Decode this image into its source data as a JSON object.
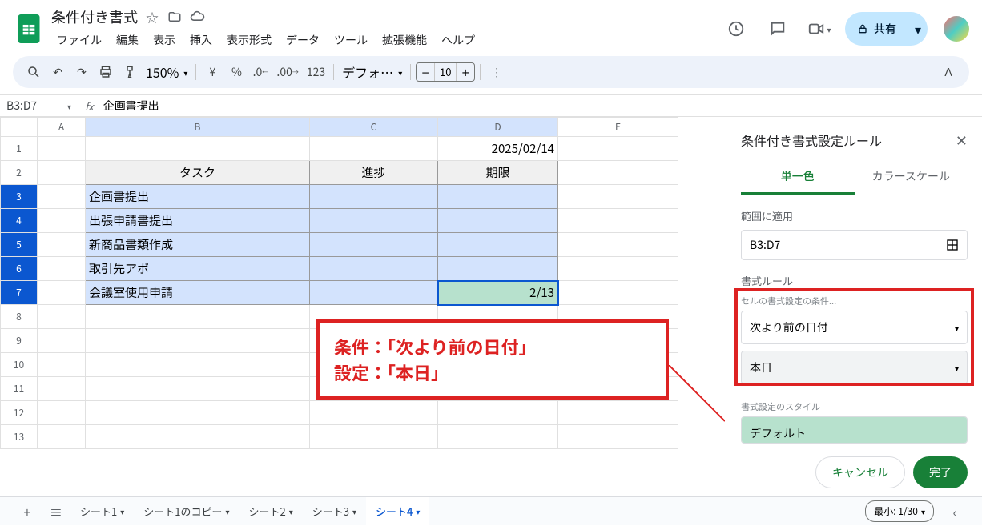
{
  "header": {
    "doc_title": "条件付き書式",
    "menus": [
      "ファイル",
      "編集",
      "表示",
      "挿入",
      "表示形式",
      "データ",
      "ツール",
      "拡張機能",
      "ヘルプ"
    ],
    "share_label": "共有"
  },
  "toolbar": {
    "zoom": "150%",
    "currency": "¥",
    "percent": "%",
    "font_name": "デフォ…",
    "font_size": "10",
    "decimal_dec": ".0",
    "decimal_inc": ".00",
    "num_format": "123"
  },
  "namebox": {
    "range": "B3:D7",
    "fx": "fx",
    "formula": "企画書提出"
  },
  "columns": [
    "A",
    "B",
    "C",
    "D",
    "E"
  ],
  "rows": [
    "1",
    "2",
    "3",
    "4",
    "5",
    "6",
    "7",
    "8",
    "9",
    "10",
    "11",
    "12",
    "13"
  ],
  "cells": {
    "D1": "2025/02/14",
    "B2": "タスク",
    "C2": "進捗",
    "D2": "期限",
    "B3": "企画書提出",
    "B4": "出張申請書提出",
    "B5": "新商品書類作成",
    "B6": "取引先アポ",
    "B7": "会議室使用申請",
    "D7": "2/13"
  },
  "callout": {
    "line1": "条件：「次より前の日付」",
    "line2": "設定：「本日」"
  },
  "side_panel": {
    "title": "条件付き書式設定ルール",
    "tab_single": "単一色",
    "tab_scale": "カラースケール",
    "apply_range_label": "範囲に適用",
    "apply_range_value": "B3:D7",
    "format_rules_label": "書式ルール",
    "condition_label": "セルの書式設定の条件...",
    "condition_value": "次より前の日付",
    "condition_sub_value": "本日",
    "style_label": "書式設定のスタイル",
    "style_preview": "デフォルト",
    "cancel": "キャンセル",
    "done": "完了"
  },
  "tabs": {
    "sheets": [
      "シート1",
      "シート1のコピー",
      "シート2",
      "シート3",
      "シート4"
    ],
    "active_index": 4,
    "min_label": "最小: 1/30"
  }
}
